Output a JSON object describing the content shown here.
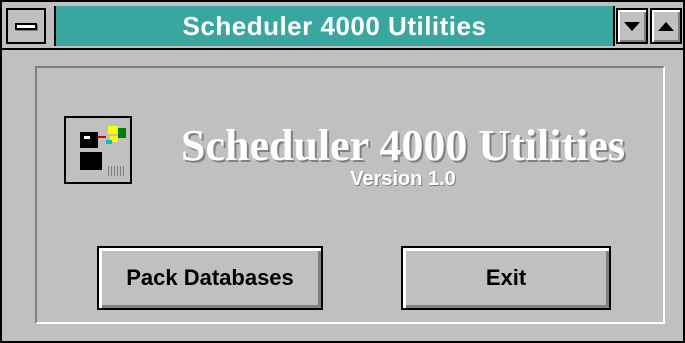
{
  "window": {
    "title": "Scheduler 4000 Utilities",
    "title_bar_color": "#3aa6a0",
    "face_color": "#c0c0c0"
  },
  "titlebar": {
    "system_menu_icon": "control-menu-icon",
    "minimize_icon": "minimize-triangle-icon",
    "maximize_icon": "maximize-triangle-icon"
  },
  "content": {
    "app_icon": "scheduler-app-icon",
    "heading": "Scheduler 4000 Utilities",
    "version": "Version 1.0"
  },
  "buttons": {
    "pack_label": "Pack Databases",
    "exit_label": "Exit"
  }
}
